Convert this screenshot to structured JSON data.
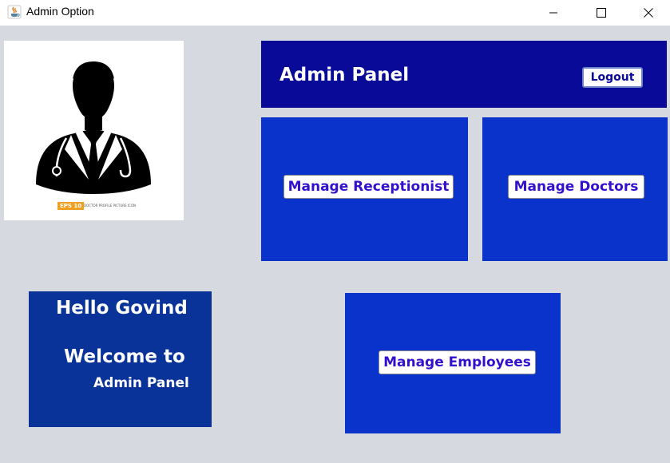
{
  "window": {
    "title": "Admin Option",
    "icons": {
      "app": "java-icon",
      "minimize": "minimize-icon",
      "maximize": "maximize-icon",
      "close": "close-icon"
    }
  },
  "profile": {
    "image_icon": "doctor-silhouette-icon",
    "badge_text": "EPS 10",
    "caption_text": "DOCTOR PROFILE PICTURE ICON"
  },
  "header": {
    "title": "Admin Panel",
    "logout_label": "Logout"
  },
  "tiles": {
    "receptionist_label": "Manage Receptionist",
    "doctors_label": "Manage Doctors",
    "employees_label": "Manage Employees"
  },
  "welcome": {
    "hello": "Hello Govind",
    "welcome_to": "Welcome to",
    "subtitle": "Admin Panel"
  },
  "colors": {
    "background": "#d6d9e0",
    "header": "#0a0a99",
    "tile": "#0a33cc",
    "welcome_panel": "#0a3399",
    "button_text": "#3311cc"
  }
}
